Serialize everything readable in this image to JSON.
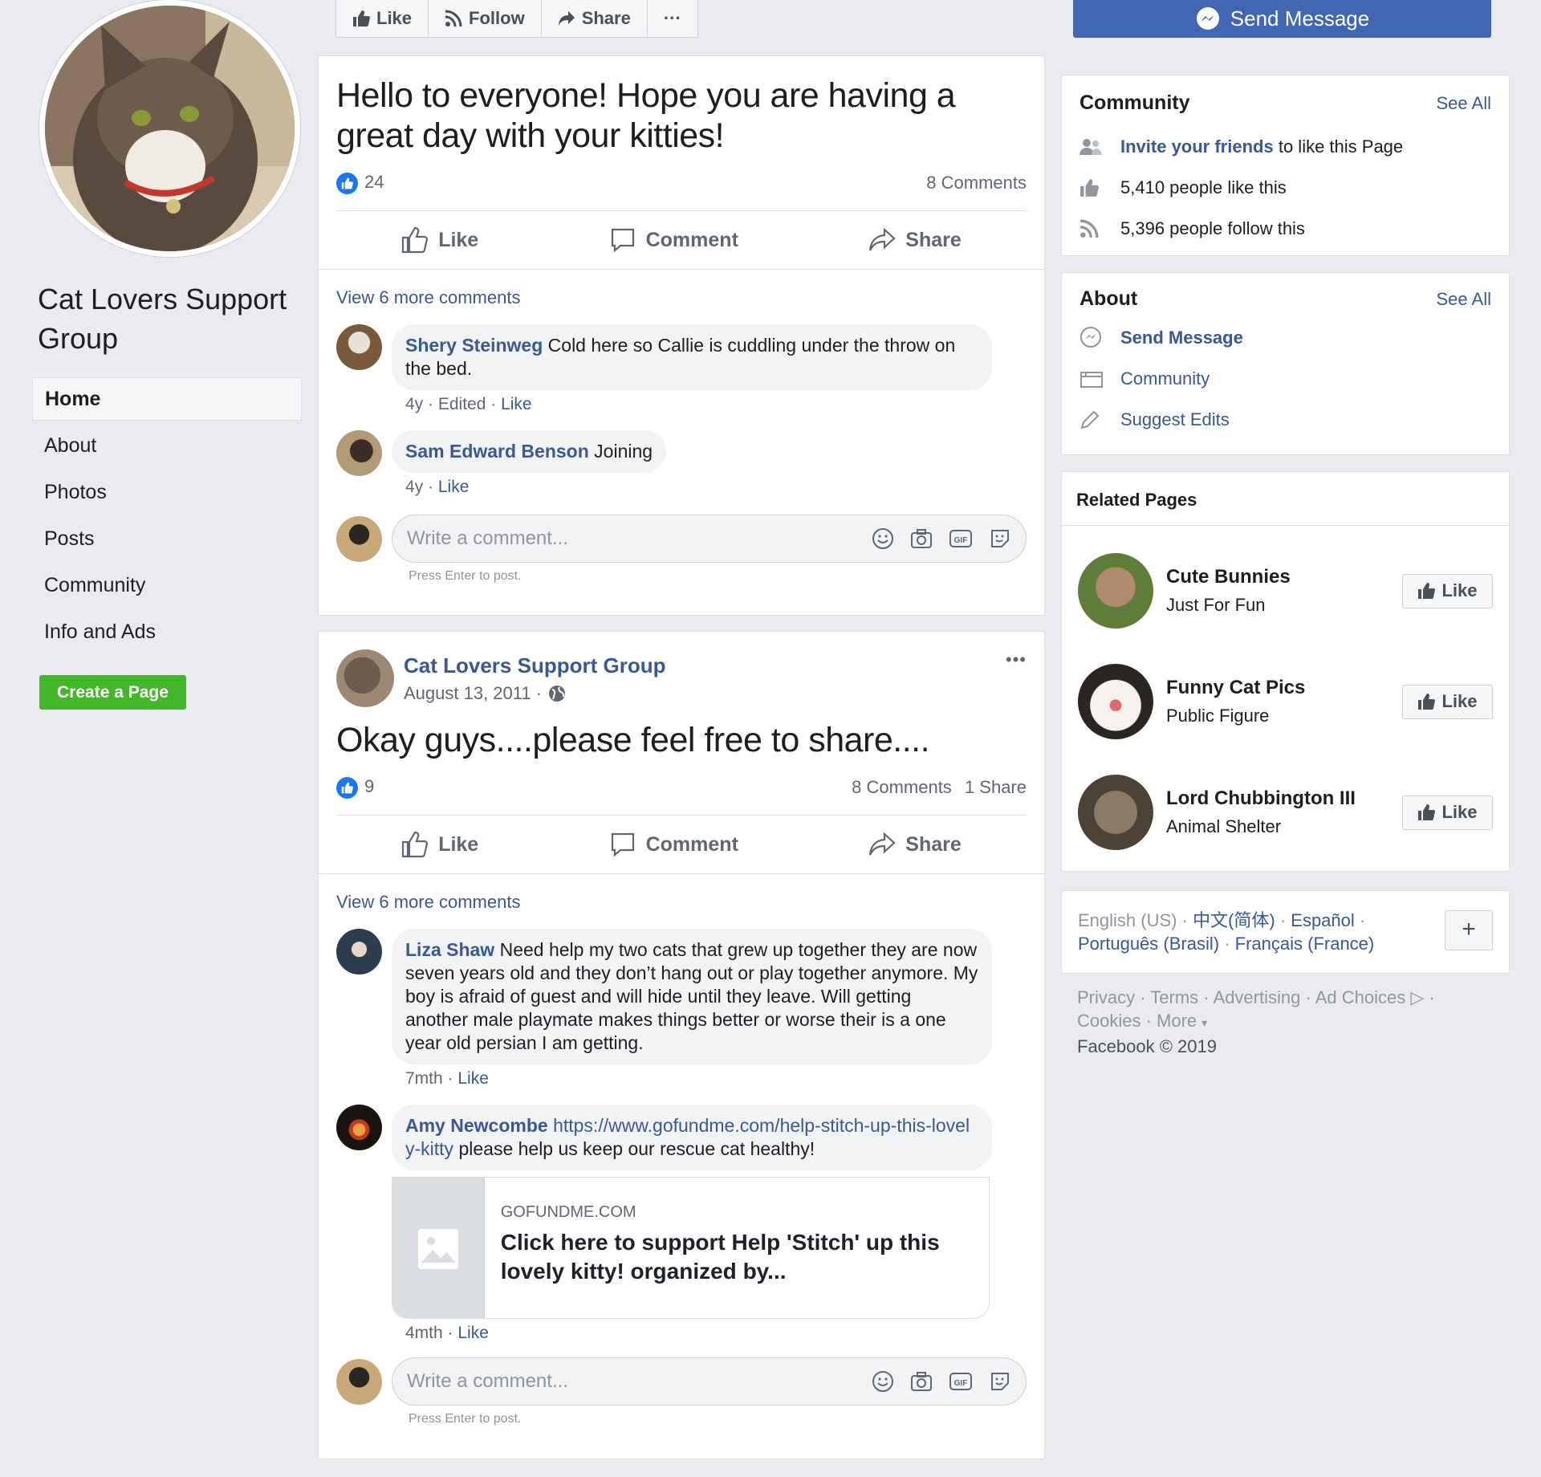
{
  "page": {
    "name": "Cat Lovers Support Group",
    "nav": [
      "Home",
      "About",
      "Photos",
      "Posts",
      "Community",
      "Info and Ads"
    ],
    "create_page": "Create a Page"
  },
  "toolbar": {
    "like": "Like",
    "follow": "Follow",
    "share": "Share",
    "more": "···",
    "send_message": "Send Message"
  },
  "actions": {
    "like": "Like",
    "comment": "Comment",
    "share": "Share"
  },
  "post1": {
    "text": "Hello to everyone! Hope you are having a great day with your kitties!",
    "likes": "24",
    "comments": "8 Comments",
    "view_more": "View 6 more comments",
    "comments_list": [
      {
        "author": "Shery Steinweg",
        "text": "Cold here so Callie is cuddling under the throw on the bed.",
        "time": "4y",
        "edited": "Edited",
        "like": "Like"
      },
      {
        "author": "Sam Edward Benson",
        "text": "Joining",
        "time": "4y",
        "like": "Like"
      }
    ],
    "write_placeholder": "Write a comment...",
    "hint": "Press Enter to post."
  },
  "post2": {
    "author": "Cat Lovers Support Group",
    "date": "August 13, 2011 ·",
    "more": "•••",
    "text": "Okay guys....please feel free to share....",
    "likes": "9",
    "comments": "8 Comments",
    "shares": "1 Share",
    "view_more": "View 6 more comments",
    "comments_list": [
      {
        "author": "Liza Shaw",
        "text": "Need help my two cats that grew up together they are now seven years old and they don’t hang out or play together anymore. My boy is afraid of guest and will hide until they leave. Will getting another male playmate makes things better or worse their is a one year old persian I am getting.",
        "time": "7mth",
        "like": "Like"
      },
      {
        "author": "Amy Newcombe",
        "url": "https://www.gofundme.com/help-stitch-up-this-lovely-kitty",
        "text": "please help us keep our rescue cat healthy!",
        "time": "4mth",
        "like": "Like"
      }
    ],
    "link_preview": {
      "domain": "GOFUNDME.COM",
      "title": "Click here to support Help 'Stitch' up this lovely kitty! organized by..."
    },
    "write_placeholder": "Write a comment...",
    "hint": "Press Enter to post."
  },
  "community": {
    "title": "Community",
    "see_all": "See All",
    "invite_link": "Invite your friends",
    "invite_rest": "to like this Page",
    "likes": "5,410 people like this",
    "follows": "5,396 people follow this"
  },
  "about": {
    "title": "About",
    "see_all": "See All",
    "items": [
      "Send Message",
      "Community",
      "Suggest Edits"
    ]
  },
  "related": {
    "title": "Related Pages",
    "like": "Like",
    "items": [
      {
        "name": "Cute Bunnies",
        "category": "Just For Fun"
      },
      {
        "name": "Funny Cat Pics",
        "category": "Public Figure"
      },
      {
        "name": "Lord Chubbington III",
        "category": "Animal Shelter"
      }
    ]
  },
  "languages": {
    "current": "English (US)",
    "others": [
      "中文(简体)",
      "Español",
      "Português (Brasil)",
      "Français (France)"
    ],
    "add": "+"
  },
  "footer": {
    "links": [
      "Privacy",
      "Terms",
      "Advertising",
      "Ad Choices",
      "Cookies",
      "More"
    ],
    "copyright": "Facebook © 2019"
  },
  "colors": {
    "brand_blue": "#4267b2",
    "link": "#385898",
    "create_green": "#42b72a",
    "background": "#e9ebee"
  }
}
